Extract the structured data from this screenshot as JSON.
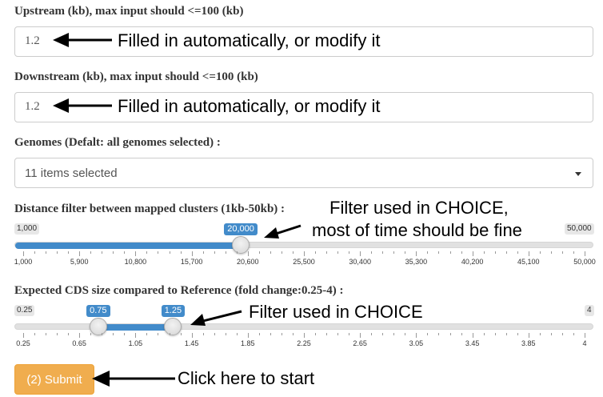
{
  "upstream": {
    "label": "Upstream (kb), max input should <=100 (kb)",
    "value": "1.2",
    "note": "Filled in automatically, or modify it"
  },
  "downstream": {
    "label": "Downstream (kb), max input should <=100 (kb)",
    "value": "1.2",
    "note": "Filled in automatically, or modify it"
  },
  "genomes": {
    "label": "Genomes (Defalt: all genomes selected) :",
    "value": "11 items selected"
  },
  "distance_slider": {
    "label": "Distance filter between mapped clusters (1kb-50kb) :",
    "min_label": "1,000",
    "max_label": "50,000",
    "value_label": "20,000",
    "min": 1000,
    "max": 50000,
    "value": 20000,
    "ticks": [
      "1,000",
      "5,900",
      "10,800",
      "15,700",
      "20,600",
      "25,500",
      "30,400",
      "35,300",
      "40,200",
      "45,100",
      "50,000"
    ],
    "note_line1": "Filter used in CHOICE,",
    "note_line2": "most of time should be fine"
  },
  "cds_slider": {
    "label": "Expected CDS size compared to Reference (fold change:0.25-4) :",
    "min_label": "0.25",
    "max_label": "4",
    "low_label": "0.75",
    "high_label": "1.25",
    "min": 0.25,
    "max": 4,
    "low": 0.75,
    "high": 1.25,
    "ticks": [
      "0.25",
      "0.65",
      "1.05",
      "1.45",
      "1.85",
      "2.25",
      "2.65",
      "3.05",
      "3.45",
      "3.85",
      "4"
    ],
    "note": "Filter used in CHOICE"
  },
  "submit": {
    "label": "(2) Submit",
    "note": "Click here to start"
  },
  "colors": {
    "slider_fill": "#428bca",
    "submit_button": "#f0ad4e"
  }
}
